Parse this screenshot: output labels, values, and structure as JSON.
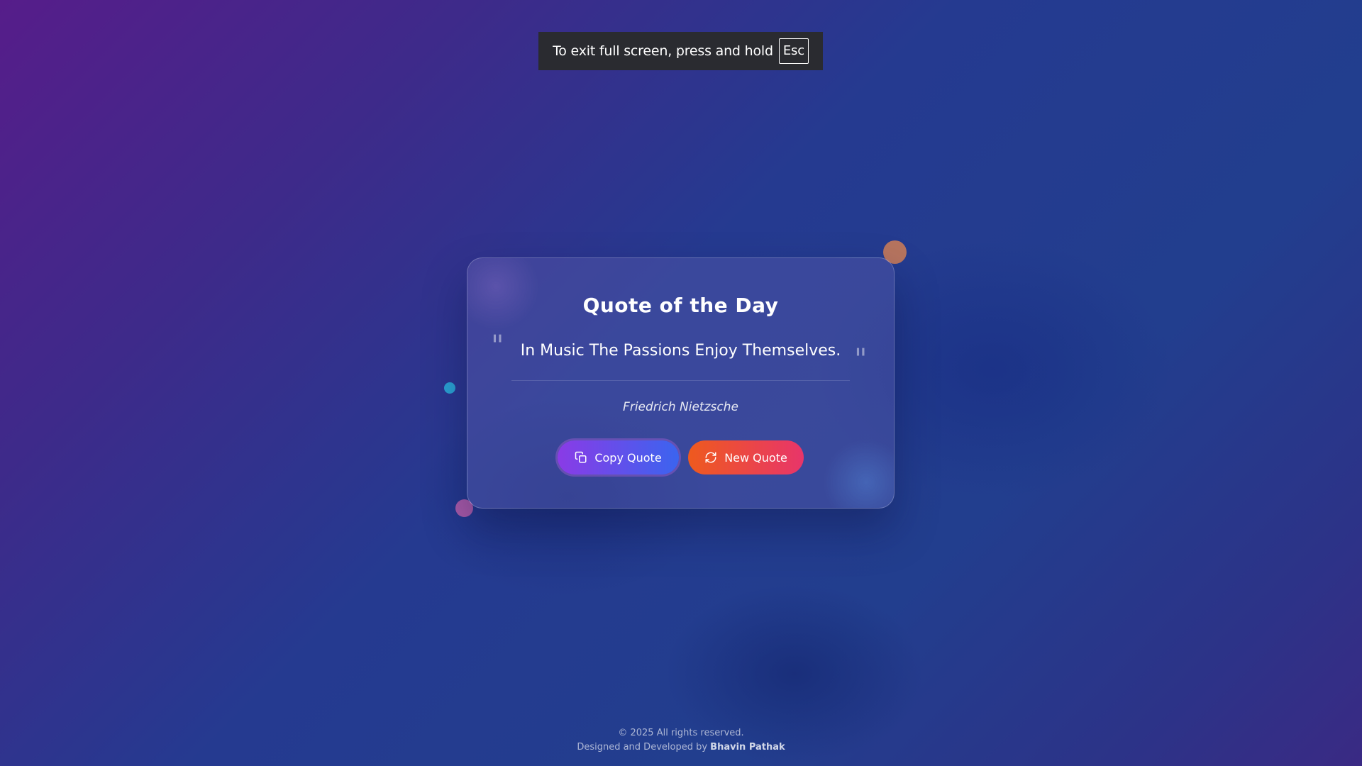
{
  "fullscreen_notice": {
    "message": "To exit full screen, press and hold",
    "key": "Esc"
  },
  "card": {
    "title": "Quote of the Day",
    "quote_open_mark": "\"",
    "quote_text": "In Music The Passions Enjoy Themselves.",
    "quote_close_mark": "\"",
    "author": "Friedrich Nietzsche",
    "copy_button_label": "Copy Quote",
    "new_button_label": "New Quote"
  },
  "footer": {
    "copyright": "© 2025 All rights reserved.",
    "credit_prefix": "Designed and Developed by",
    "developer_name": "Bhavin Pathak"
  },
  "icons": {
    "copy_button": "copy-icon",
    "new_button": "refresh-icon"
  },
  "colors": {
    "copy_button_gradient": [
      "#8a3be6",
      "#3b64ef"
    ],
    "new_button_gradient": [
      "#ee5a1e",
      "#e8356a"
    ],
    "accent_dots": [
      "#b6745f",
      "#2a9fd0",
      "#a85aa8"
    ]
  }
}
